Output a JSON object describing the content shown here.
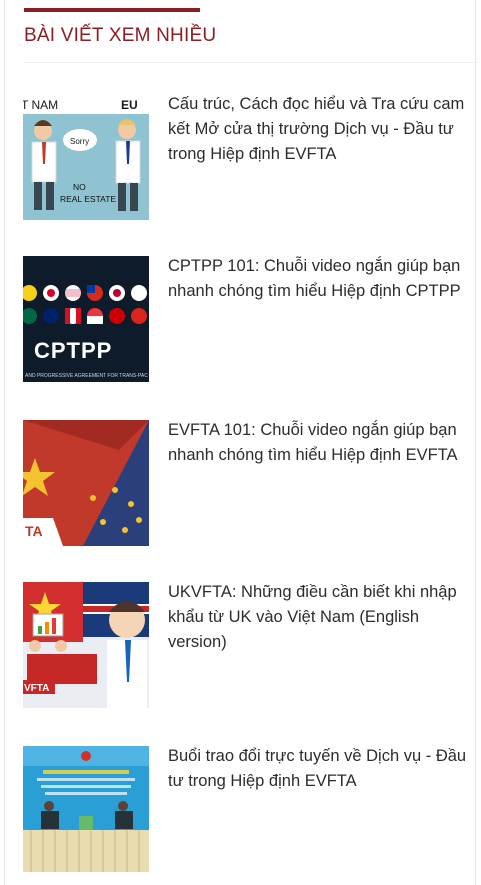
{
  "widget": {
    "title": "BÀI VIẾT XEM NHIỀU",
    "accent_color": "#8b1e24"
  },
  "articles": [
    {
      "title": "Cấu trúc, Cách đọc hiểu và Tra cứu cam kết Mở cửa thị trường Dịch vụ - Đầu tư trong Hiệp định EVFTA",
      "thumb": {
        "left_label": "T NAM",
        "right_label": "EU",
        "bubble": "Sorry",
        "sign_line1": "NO",
        "sign_line2": "REAL ESTATE"
      }
    },
    {
      "title": "CPTPP 101: Chuỗi video ngắn giúp bạn nhanh chóng tìm hiểu Hiệp định CPTPP",
      "thumb": {
        "logo": "CPTPP",
        "subtitle": "AND PROGRESSIVE AGREEMENT FOR TRANS-PAC"
      }
    },
    {
      "title": "EVFTA 101: Chuỗi video ngắn giúp bạn nhanh chóng tìm hiểu Hiệp định EVFTA",
      "thumb": {
        "label": "TA"
      }
    },
    {
      "title": "UKVFTA: Những điều cần biết khi nhập khẩu từ UK vào Việt Nam (English version)",
      "thumb": {
        "label": "VFTA"
      }
    },
    {
      "title": "Buổi trao đổi trực tuyến về Dịch vụ - Đầu tư trong Hiệp định EVFTA",
      "thumb": {}
    }
  ]
}
